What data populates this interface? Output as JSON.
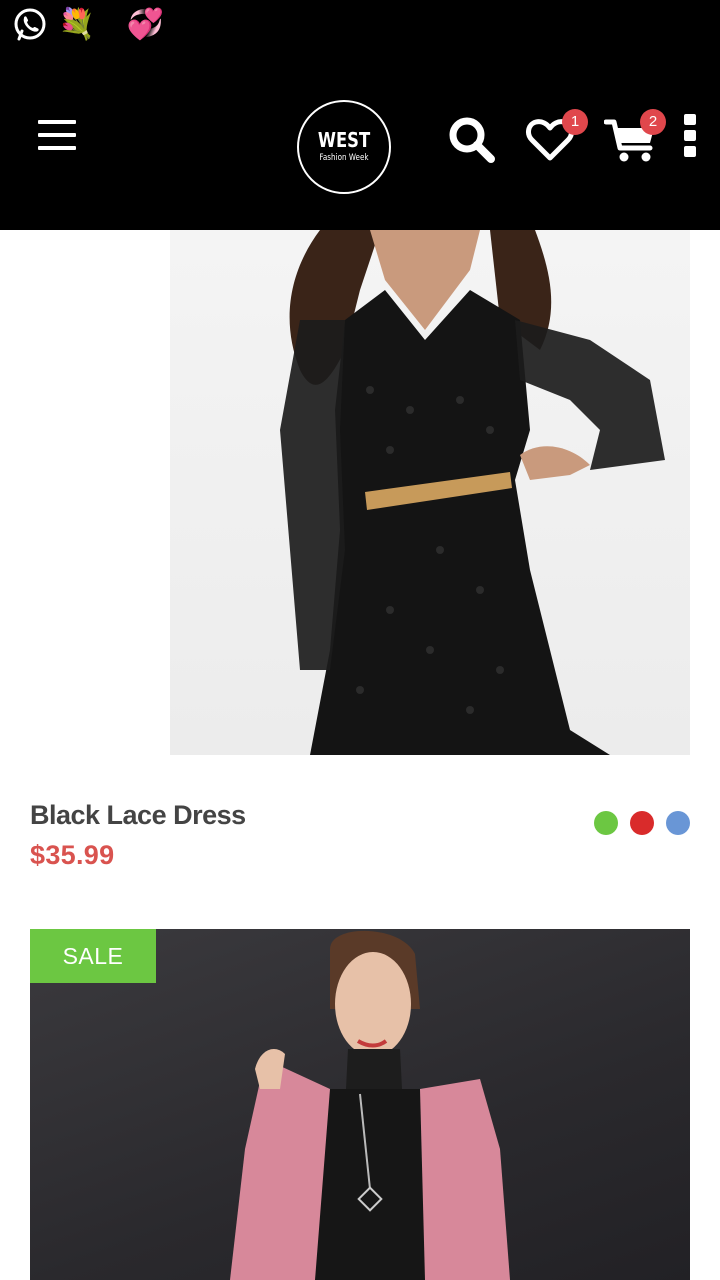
{
  "status_bar": {
    "emojis": "💐😘💞",
    "app_icon": "whatsapp-icon"
  },
  "header": {
    "menu_icon": "hamburger-menu-icon",
    "logo_line1": "WEST",
    "logo_line2": "Fashion Week",
    "search_icon": "search-icon",
    "wishlist_icon": "heart-icon",
    "wishlist_count": "1",
    "cart_icon": "cart-icon",
    "cart_count": "2",
    "more_icon": "more-vertical-icon"
  },
  "products": [
    {
      "name": "Black Lace Dress",
      "price": "$35.99",
      "colors": [
        "#6cc742",
        "#d92b2b",
        "#6996d6"
      ],
      "image_icon": "black-lace-dress-photo"
    },
    {
      "badge": "SALE",
      "image_icon": "pink-coat-model-photo"
    }
  ],
  "colors": {
    "header_bg": "#000000",
    "badge_red": "#e0474c",
    "price_red": "#d9534f",
    "sale_green": "#6cc742"
  }
}
